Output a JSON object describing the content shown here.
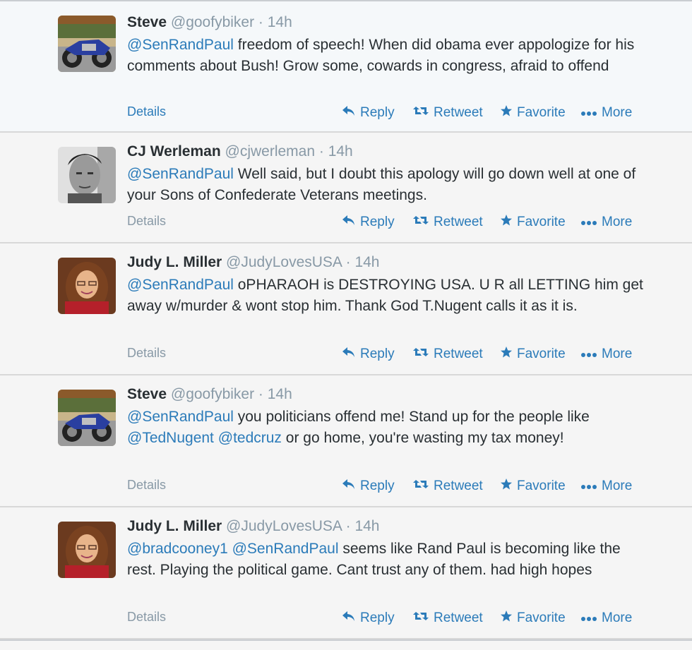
{
  "tweets": [
    {
      "name": "Steve",
      "handle": "@goofybiker",
      "time": "· 14h",
      "segments": [
        {
          "text": "@SenRandPaul",
          "mention": true
        },
        {
          "text": " freedom of speech! When did obama ever appologize for his comments about Bush! Grow some, cowards in congress, afraid to offend",
          "mention": false
        }
      ],
      "details": "Details",
      "avatar": "motorcycle"
    },
    {
      "name": "CJ Werleman",
      "handle": "@cjwerleman",
      "time": "· 14h",
      "segments": [
        {
          "text": "@SenRandPaul",
          "mention": true
        },
        {
          "text": " Well said, but I doubt this apology will go down well at one of your Sons of Confederate Veterans meetings.",
          "mention": false
        }
      ],
      "details": "Details",
      "avatar": "man"
    },
    {
      "name": "Judy L. Miller",
      "handle": "@JudyLovesUSA",
      "time": "· 14h",
      "segments": [
        {
          "text": "@SenRandPaul",
          "mention": true
        },
        {
          "text": " oPHARAOH is DESTROYING USA. U R all LETTING him get away w/murder & wont stop him. Thank God T.Nugent calls it as it is.",
          "mention": false
        }
      ],
      "details": "Details",
      "avatar": "woman"
    },
    {
      "name": "Steve",
      "handle": "@goofybiker",
      "time": "· 14h",
      "segments": [
        {
          "text": "@SenRandPaul",
          "mention": true
        },
        {
          "text": " you politicians offend me! Stand up for the people like ",
          "mention": false
        },
        {
          "text": "@TedNugent",
          "mention": true
        },
        {
          "text": " ",
          "mention": false
        },
        {
          "text": "@tedcruz",
          "mention": true
        },
        {
          "text": "  or go home, you're wasting my tax money!",
          "mention": false
        }
      ],
      "details": "Details",
      "avatar": "motorcycle"
    },
    {
      "name": "Judy L. Miller",
      "handle": "@JudyLovesUSA",
      "time": "· 14h",
      "segments": [
        {
          "text": "@bradcooney1",
          "mention": true
        },
        {
          "text": " ",
          "mention": false
        },
        {
          "text": "@SenRandPaul",
          "mention": true
        },
        {
          "text": " seems like Rand Paul is becoming like the rest. Playing the political game. Cant trust any of them. had high hopes",
          "mention": false
        }
      ],
      "details": "Details",
      "avatar": "woman"
    }
  ],
  "actions": {
    "reply": "Reply",
    "retweet": "Retweet",
    "favorite": "Favorite",
    "more": "More"
  },
  "colors": {
    "link": "#2b7bb9",
    "muted": "#8899a6",
    "text": "#292f33"
  }
}
